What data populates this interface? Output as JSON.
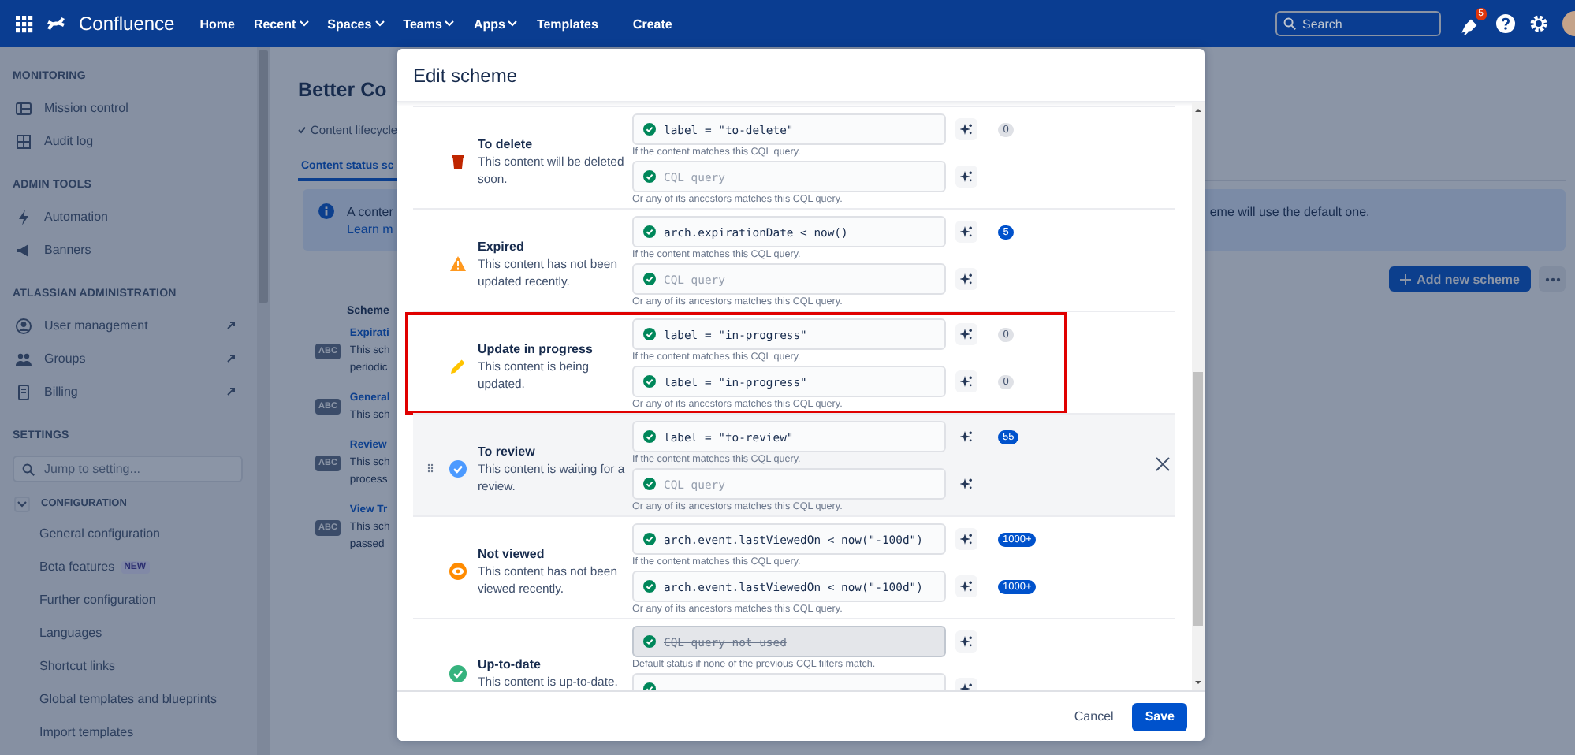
{
  "nav": {
    "product": "Confluence",
    "items": [
      {
        "label": "Home",
        "dropdown": false
      },
      {
        "label": "Recent",
        "dropdown": true
      },
      {
        "label": "Spaces",
        "dropdown": true
      },
      {
        "label": "Teams",
        "dropdown": true
      },
      {
        "label": "Apps",
        "dropdown": true
      },
      {
        "label": "Templates",
        "dropdown": false
      }
    ],
    "create": "Create",
    "search": {
      "placeholder": "Search"
    },
    "notifications": "5"
  },
  "sidebar": {
    "sections": [
      {
        "heading": "MONITORING",
        "items": [
          {
            "label": "Mission control",
            "external": false
          },
          {
            "label": "Audit log",
            "external": false
          }
        ]
      },
      {
        "heading": "ADMIN TOOLS",
        "items": [
          {
            "label": "Automation",
            "external": false
          },
          {
            "label": "Banners",
            "external": false
          }
        ]
      },
      {
        "heading": "ATLASSIAN ADMINISTRATION",
        "items": [
          {
            "label": "User management",
            "external": true
          },
          {
            "label": "Groups",
            "external": true
          },
          {
            "label": "Billing",
            "external": true
          }
        ]
      }
    ],
    "settings": {
      "heading": "SETTINGS",
      "search": {
        "placeholder": "Jump to setting..."
      },
      "group": {
        "label": "CONFIGURATION",
        "expanded": true,
        "items": [
          {
            "label": "General configuration"
          },
          {
            "label": "Beta features",
            "badge": "NEW"
          },
          {
            "label": "Further configuration"
          },
          {
            "label": "Languages"
          },
          {
            "label": "Shortcut links"
          },
          {
            "label": "Global templates and blueprints"
          },
          {
            "label": "Import templates"
          }
        ]
      }
    }
  },
  "page": {
    "title": "Better Co",
    "breadcrumb": "Content lifecycle",
    "tabs": [
      {
        "label": "Content status sc",
        "selected": true
      }
    ],
    "info": {
      "lines": [
        "A conter",
        "Learn m"
      ],
      "tail": "eme will use the default one."
    },
    "add_button": "Add new scheme",
    "schemes_heading": "Scheme",
    "schemes": [
      {
        "badge": "ABC",
        "name": "Expirati",
        "lines": [
          "This sch",
          "periodic"
        ]
      },
      {
        "badge": "ABC",
        "name": "General",
        "lines": [
          "This sch"
        ]
      },
      {
        "badge": "ABC",
        "name": "Review",
        "lines": [
          "This sch",
          "process"
        ]
      },
      {
        "badge": "ABC",
        "name": "View Tr",
        "lines": [
          "This sch",
          "passed"
        ]
      }
    ]
  },
  "modal": {
    "title": "Edit scheme",
    "statuses": [
      {
        "kind": "delete",
        "name": "To delete",
        "description": "This content will be deleted soon.",
        "highlighted": false,
        "hovered": false,
        "queries": [
          {
            "value": "label = \"to-delete\"",
            "count": "0",
            "color": "#dfe1e6",
            "hint": "If the content matches this CQL query."
          },
          {
            "placeholder": "CQL query",
            "hint": "Or any of its ancestors matches this CQL query."
          }
        ]
      },
      {
        "kind": "expired",
        "name": "Expired",
        "description": "This content has not been updated recently.",
        "highlighted": false,
        "hovered": false,
        "queries": [
          {
            "value": "arch.expirationDate < now()",
            "count": "5",
            "color": "#0052cc",
            "hint": "If the content matches this CQL query."
          },
          {
            "placeholder": "CQL query",
            "hint": "Or any of its ancestors matches this CQL query."
          }
        ]
      },
      {
        "kind": "progress",
        "name": "Update in progress",
        "description": "This content is being updated.",
        "highlighted": true,
        "hovered": false,
        "queries": [
          {
            "value": "label = \"in-progress\"",
            "count": "0",
            "color": "#dfe1e6",
            "hint": "If the content matches this CQL query."
          },
          {
            "value": "label = \"in-progress\"",
            "count": "0",
            "color": "#dfe1e6",
            "hint": "Or any of its ancestors matches this CQL query."
          }
        ]
      },
      {
        "kind": "review",
        "name": "To review",
        "description": "This content is waiting for a review.",
        "highlighted": false,
        "hovered": true,
        "queries": [
          {
            "value": "label = \"to-review\"",
            "count": "55",
            "color": "#0052cc",
            "hint": "If the content matches this CQL query."
          },
          {
            "placeholder": "CQL query",
            "hint": "Or any of its ancestors matches this CQL query."
          }
        ]
      },
      {
        "kind": "not_viewed",
        "name": "Not viewed",
        "description": "This content has not been viewed recently.",
        "highlighted": false,
        "hovered": false,
        "queries": [
          {
            "value": "arch.event.lastViewedOn < now(\"-100d\")",
            "count": "1000+",
            "color": "#0052cc",
            "hint": "If the content matches this CQL query."
          },
          {
            "value": "arch.event.lastViewedOn < now(\"-100d\")",
            "count": "1000+",
            "color": "#0052cc",
            "hint": "Or any of its ancestors matches this CQL query."
          }
        ]
      },
      {
        "kind": "uptodate",
        "name": "Up-to-date",
        "description": "This content is up-to-date.",
        "highlighted": false,
        "hovered": false,
        "queries": [
          {
            "value": "CQL query not used",
            "unused": true,
            "hint": "Default status if none of the previous CQL filters match."
          },
          {
            "unused": false
          }
        ]
      }
    ],
    "cancel": "Cancel",
    "save": "Save"
  }
}
